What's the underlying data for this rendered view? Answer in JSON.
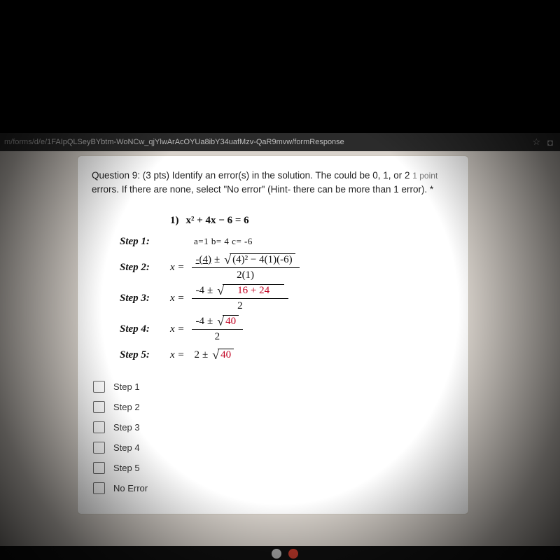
{
  "browser": {
    "url": "m/forms/d/e/1FAIpQLSeyBYbtm-WoNCw_qjYlwArAcOYUa8ibY34uafMzv-QaR9mvw/formResponse",
    "star": "☆",
    "ext": "◘"
  },
  "question": {
    "prefix": "Question 9: (3 pts) Identify an error(s) in the solution. The could be 0, 1, or 2 ",
    "points": "1 point",
    "rest": "errors. If there are none, select \"No error\" (Hint- there can be more than 1 error). *"
  },
  "work": {
    "header_num": "1)",
    "header_eq": "x² + 4x − 6 = 6",
    "step1": "Step 1:",
    "abc": "a=1  b= 4  c= -6",
    "step2": "Step 2:",
    "s2_lead": "-(4)",
    "s2_rad": "(4)² − 4(1)(-6)",
    "s2_den": "2(1)",
    "step3": "Step 3:",
    "s3_lead": "-4",
    "s3_rad": "16 + 24",
    "s3_den": "2",
    "step4": "Step 4:",
    "s4_lead": "-4",
    "s4_rad": "40",
    "s4_den": "2",
    "step5": "Step 5:",
    "s5_lead": "2",
    "s5_rad": "40",
    "xeq": "x ="
  },
  "options": [
    {
      "label": "Step 1"
    },
    {
      "label": "Step 2"
    },
    {
      "label": "Step 3"
    },
    {
      "label": "Step 4"
    },
    {
      "label": "Step 5"
    },
    {
      "label": "No Error"
    }
  ]
}
